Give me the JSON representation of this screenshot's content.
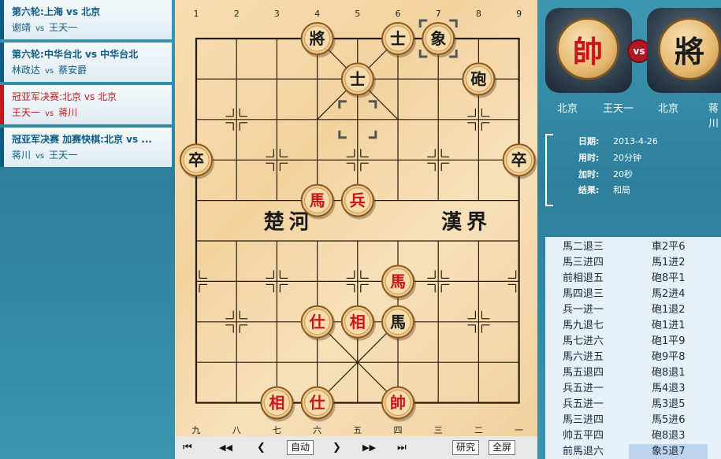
{
  "matches": [
    {
      "round": "第六轮:",
      "teams": "上海 vs 北京",
      "p1": "谢靖",
      "vs": "vs",
      "p2": "王天一",
      "highlight": false
    },
    {
      "round": "第六轮:",
      "teams": "中华台北 vs 中华台北",
      "p1": "林政达",
      "vs": "vs",
      "p2": "蔡安爵",
      "highlight": false
    },
    {
      "round": "冠亚军决赛:",
      "teams": "北京 vs 北京",
      "p1": "王天一",
      "vs": "vs",
      "p2": "蒋川",
      "highlight": true
    },
    {
      "round": "冠亚军决赛 加赛快棋:",
      "teams": "北京 vs ...",
      "p1": "蒋川",
      "vs": "vs",
      "p2": "王天一",
      "highlight": false
    }
  ],
  "board": {
    "file_numbers_top": [
      "1",
      "2",
      "3",
      "4",
      "5",
      "6",
      "7",
      "8",
      "9"
    ],
    "file_numbers_bottom": [
      "九",
      "八",
      "七",
      "六",
      "五",
      "四",
      "三",
      "二",
      "一"
    ],
    "river_left": "楚河",
    "river_right": "漢界",
    "pieces": [
      {
        "ch": "將",
        "side": "black",
        "col": 4,
        "row": 0
      },
      {
        "ch": "士",
        "side": "black",
        "col": 6,
        "row": 0
      },
      {
        "ch": "象",
        "side": "black",
        "col": 7,
        "row": 0
      },
      {
        "ch": "士",
        "side": "black",
        "col": 5,
        "row": 1
      },
      {
        "ch": "砲",
        "side": "black",
        "col": 8,
        "row": 1
      },
      {
        "ch": "卒",
        "side": "black",
        "col": 1,
        "row": 3
      },
      {
        "ch": "卒",
        "side": "black",
        "col": 9,
        "row": 3
      },
      {
        "ch": "馬",
        "side": "red",
        "col": 4,
        "row": 4
      },
      {
        "ch": "兵",
        "side": "red",
        "col": 5,
        "row": 4
      },
      {
        "ch": "馬",
        "side": "red",
        "col": 6,
        "row": 6
      },
      {
        "ch": "仕",
        "side": "red",
        "col": 4,
        "row": 7
      },
      {
        "ch": "相",
        "side": "red",
        "col": 5,
        "row": 7
      },
      {
        "ch": "馬",
        "side": "black",
        "col": 6,
        "row": 7
      },
      {
        "ch": "相",
        "side": "red",
        "col": 3,
        "row": 9
      },
      {
        "ch": "仕",
        "side": "red",
        "col": 4,
        "row": 9
      },
      {
        "ch": "帥",
        "side": "red",
        "col": 6,
        "row": 9
      }
    ],
    "last_move": {
      "from": {
        "col": 5,
        "row": 2
      },
      "to": {
        "col": 7,
        "row": 0
      }
    }
  },
  "controls": {
    "first": "⏮",
    "fast_back": "◀◀",
    "back": "❮",
    "auto": "自动",
    "forward": "❯",
    "fast_forward": "▶▶",
    "last": "⏭",
    "research": "研究",
    "fullscreen": "全屏"
  },
  "players": {
    "red": {
      "piece": "帥",
      "team": "北京",
      "name": "王天一"
    },
    "vs": "vs",
    "black": {
      "piece": "將",
      "team": "北京",
      "name": "蒋川"
    }
  },
  "info": {
    "date_label": "日期:",
    "date": "2013-4-26",
    "time_label": "用时:",
    "time": "20分钟",
    "inc_label": "加时:",
    "inc": "20秒",
    "result_label": "结果:",
    "result": "和局"
  },
  "moves": [
    {
      "red": "馬二退三",
      "black": "車2平6"
    },
    {
      "red": "馬三进四",
      "black": "馬1进2"
    },
    {
      "red": "前相退五",
      "black": "砲8平1"
    },
    {
      "red": "馬四退三",
      "black": "馬2进4"
    },
    {
      "red": "兵一进一",
      "black": "砲1退2"
    },
    {
      "red": "馬九退七",
      "black": "砲1进1"
    },
    {
      "red": "馬七进六",
      "black": "砲1平9"
    },
    {
      "red": "馬六进五",
      "black": "砲9平8"
    },
    {
      "red": "馬五退四",
      "black": "砲8退1"
    },
    {
      "red": "兵五进一",
      "black": "馬4退3"
    },
    {
      "red": "兵五进一",
      "black": "馬3退5"
    },
    {
      "red": "馬三进四",
      "black": "馬5进6"
    },
    {
      "red": "帅五平四",
      "black": "砲8退3"
    },
    {
      "red": "前馬退六",
      "black": "象5退7",
      "current": true
    }
  ],
  "colors": {
    "red_piece": "#c8141a",
    "black_piece": "#1b1b1b",
    "board_line": "#2a1a0a",
    "highlight_row": "#bcd4ee"
  }
}
